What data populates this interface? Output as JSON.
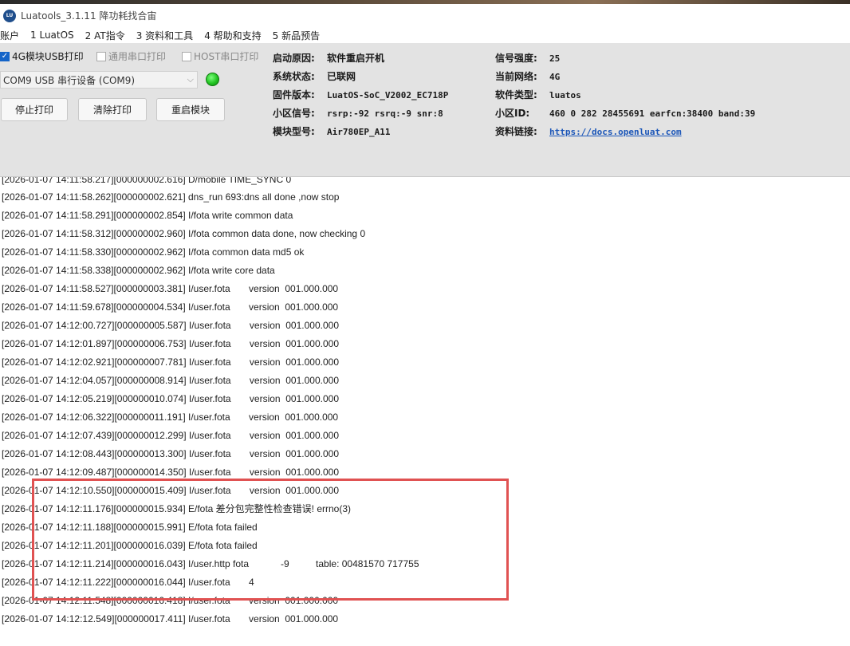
{
  "window": {
    "title": "Luatools_3.1.11 降功耗找合宙",
    "icon": "luatools-icon"
  },
  "menu": [
    "账户",
    "1 LuatOS",
    "2 AT指令",
    "3 资料和工具",
    "4 帮助和支持",
    "5 新品预告"
  ],
  "options": {
    "usb_print": {
      "label": "4G模块USB打印",
      "checked": true
    },
    "serial_print": {
      "label": "通用串口打印",
      "checked": false
    },
    "host_print": {
      "label": "HOST串口打印",
      "checked": false
    }
  },
  "port": {
    "value": "COM9 USB 串行设备 (COM9)",
    "status_color": "#22c422"
  },
  "buttons": {
    "stop": "停止打印",
    "clear": "清除打印",
    "restart": "重启模块"
  },
  "info": {
    "boot_reason": {
      "label": "启动原因:",
      "value": "软件重启开机"
    },
    "sys_state": {
      "label": "系统状态:",
      "value": "已联网"
    },
    "firmware": {
      "label": "固件版本:",
      "value": "LuatOS-SoC_V2002_EC718P"
    },
    "cell_signal": {
      "label": "小区信号:",
      "value": "rsrp:-92 rsrq:-9 snr:8"
    },
    "model": {
      "label": "模块型号:",
      "value": "Air780EP_A11"
    },
    "signal": {
      "label": "信号强度:",
      "value": "25"
    },
    "network": {
      "label": "当前网络:",
      "value": "4G"
    },
    "sw_type": {
      "label": "软件类型:",
      "value": "luatos"
    },
    "cell_id": {
      "label": "小区ID:",
      "value": "460 0 282 28455691 earfcn:38400 band:39"
    },
    "docs": {
      "label": "资料链接:",
      "value": "https://docs.openluat.com"
    }
  },
  "log": [
    "[2026-01-07 14:11:58.217][000000002.616] D/mobile TIME_SYNC 0",
    "[2026-01-07 14:11:58.262][000000002.621] dns_run 693:dns all done ,now stop",
    "[2026-01-07 14:11:58.291][000000002.854] I/fota write common data",
    "[2026-01-07 14:11:58.312][000000002.960] I/fota common data done, now checking 0",
    "[2026-01-07 14:11:58.330][000000002.962] I/fota common data md5 ok",
    "[2026-01-07 14:11:58.338][000000002.962] I/fota write core data",
    "[2026-01-07 14:11:58.527][000000003.381] I/user.fota       version  001.000.000",
    "[2026-01-07 14:11:59.678][000000004.534] I/user.fota       version  001.000.000",
    "[2026-01-07 14:12:00.727][000000005.587] I/user.fota       version  001.000.000",
    "[2026-01-07 14:12:01.897][000000006.753] I/user.fota       version  001.000.000",
    "[2026-01-07 14:12:02.921][000000007.781] I/user.fota       version  001.000.000",
    "[2026-01-07 14:12:04.057][000000008.914] I/user.fota       version  001.000.000",
    "[2026-01-07 14:12:05.219][000000010.074] I/user.fota       version  001.000.000",
    "[2026-01-07 14:12:06.322][000000011.191] I/user.fota       version  001.000.000",
    "[2026-01-07 14:12:07.439][000000012.299] I/user.fota       version  001.000.000",
    "[2026-01-07 14:12:08.443][000000013.300] I/user.fota       version  001.000.000",
    "[2026-01-07 14:12:09.487][000000014.350] I/user.fota       version  001.000.000",
    "[2026-01-07 14:12:10.550][000000015.409] I/user.fota       version  001.000.000",
    "[2026-01-07 14:12:11.176][000000015.934] E/fota 差分包完整性检查错误! errno(3)",
    "[2026-01-07 14:12:11.188][000000015.991] E/fota fota failed",
    "[2026-01-07 14:12:11.201][000000016.039] E/fota fota failed",
    "[2026-01-07 14:12:11.214][000000016.043] I/user.http fota            -9          table: 00481570 717755",
    "[2026-01-07 14:12:11.222][000000016.044] I/user.fota       4",
    "[2026-01-07 14:12:11.548][000000016.418] I/user.fota       version  001.000.000",
    "[2026-01-07 14:12:12.549][000000017.411] I/user.fota       version  001.000.000"
  ]
}
